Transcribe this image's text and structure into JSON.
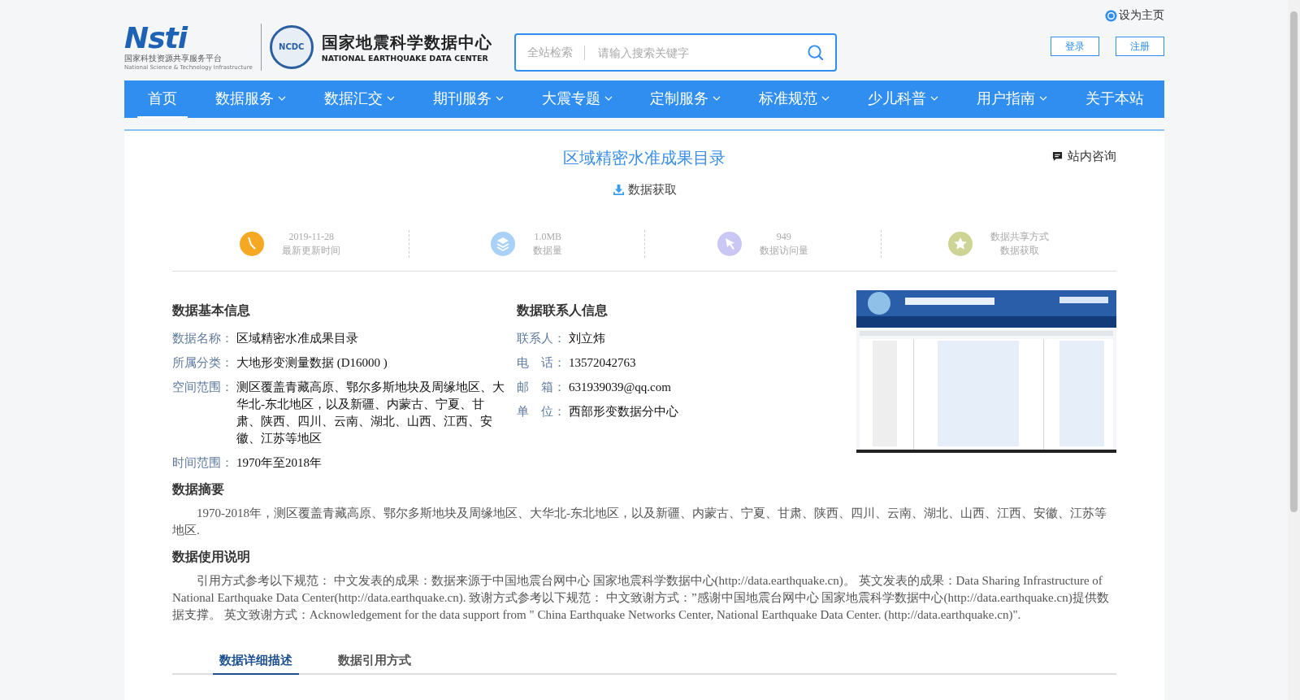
{
  "header": {
    "platform_logo": {
      "mark": "Nsti",
      "name": "国家科技资源共享服务平台",
      "name_en": "National Science & Technology Infrastructure"
    },
    "center_logo": {
      "badge": "NCDC",
      "name": "国家地震科学数据中心",
      "name_en": "NATIONAL EARTHQUAKE DATA CENTER"
    },
    "search": {
      "scope": "全站检索",
      "placeholder": "请输入搜索关键字"
    },
    "set_homepage": "设为主页",
    "buttons": [
      "登录",
      "注册"
    ]
  },
  "nav": [
    {
      "label": "首页",
      "dropdown": false,
      "selected": true
    },
    {
      "label": "数据服务",
      "dropdown": true,
      "selected": false
    },
    {
      "label": "数据汇交",
      "dropdown": true,
      "selected": false
    },
    {
      "label": "期刊服务",
      "dropdown": true,
      "selected": false
    },
    {
      "label": "大震专题",
      "dropdown": true,
      "selected": false
    },
    {
      "label": "定制服务",
      "dropdown": true,
      "selected": false
    },
    {
      "label": "标准规范",
      "dropdown": true,
      "selected": false
    },
    {
      "label": "少儿科普",
      "dropdown": true,
      "selected": false
    },
    {
      "label": "用户指南",
      "dropdown": true,
      "selected": false
    },
    {
      "label": "关于本站",
      "dropdown": false,
      "selected": false
    }
  ],
  "dataset": {
    "title": "区域精密水准成果目录",
    "download": "数据获取",
    "consult": "站内咨询",
    "stats": [
      {
        "kind": "clock",
        "color": "#f7a823",
        "value": "2019-11-28",
        "label": "最新更新时间"
      },
      {
        "kind": "layers",
        "color": "#a9d0f7",
        "value": "1.0MB",
        "label": "数据量"
      },
      {
        "kind": "cursor",
        "color": "#cbc7f4",
        "value": "949",
        "label": "数据访问量"
      },
      {
        "kind": "star",
        "color": "#cdd494",
        "value": "数据共享方式",
        "label": "数据获取"
      }
    ],
    "basic_info": {
      "heading": "数据基本信息",
      "fields": [
        {
          "label": "数据名称：",
          "value": "区域精密水准成果目录"
        },
        {
          "label": "所属分类：",
          "value": "大地形变测量数据 (D16000 )"
        },
        {
          "label": "空间范围：",
          "value": "测区覆盖青藏高原、鄂尔多斯地块及周缘地区、大华北-东北地区，以及新疆、内蒙古、宁夏、甘肃、陕西、四川、云南、湖北、山西、江西、安徽、江苏等地区"
        },
        {
          "label": "时间范围：",
          "value": "1970年至2018年"
        }
      ]
    },
    "contact_info": {
      "heading": "数据联系人信息",
      "fields": [
        {
          "label": "联系人：",
          "value": "刘立炜"
        },
        {
          "label": "电　话：",
          "value": "13572042763"
        },
        {
          "label": "邮　箱：",
          "value": "631939039@qq.com"
        },
        {
          "label": "单　位：",
          "value": "西部形变数据分中心"
        }
      ]
    },
    "summary": {
      "heading": "数据摘要",
      "text": "1970-2018年，测区覆盖青藏高原、鄂尔多斯地块及周缘地区、大华北-东北地区，以及新疆、内蒙古、宁夏、甘肃、陕西、四川、云南、湖北、山西、江西、安徽、江苏等地区."
    },
    "usage": {
      "heading": "数据使用说明",
      "text": "引用方式参考以下规范： 中文发表的成果：数据来源于中国地震台网中心 国家地震科学数据中心(http://data.earthquake.cn)。 英文发表的成果：Data Sharing Infrastructure of National Earthquake Data Center(http://data.earthquake.cn). 致谢方式参考以下规范： 中文致谢方式：”感谢中国地震台网中心 国家地震科学数据中心(http://data.earthquake.cn)提供数据支撑。 英文致谢方式：Acknowledgement for the data support from \" China Earthquake Networks Center, National Earthquake Data Center. (http://data.earthquake.cn)\"."
    },
    "tabs": [
      {
        "label": "数据详细描述",
        "selected": true
      },
      {
        "label": "数据引用方式",
        "selected": false
      }
    ]
  }
}
